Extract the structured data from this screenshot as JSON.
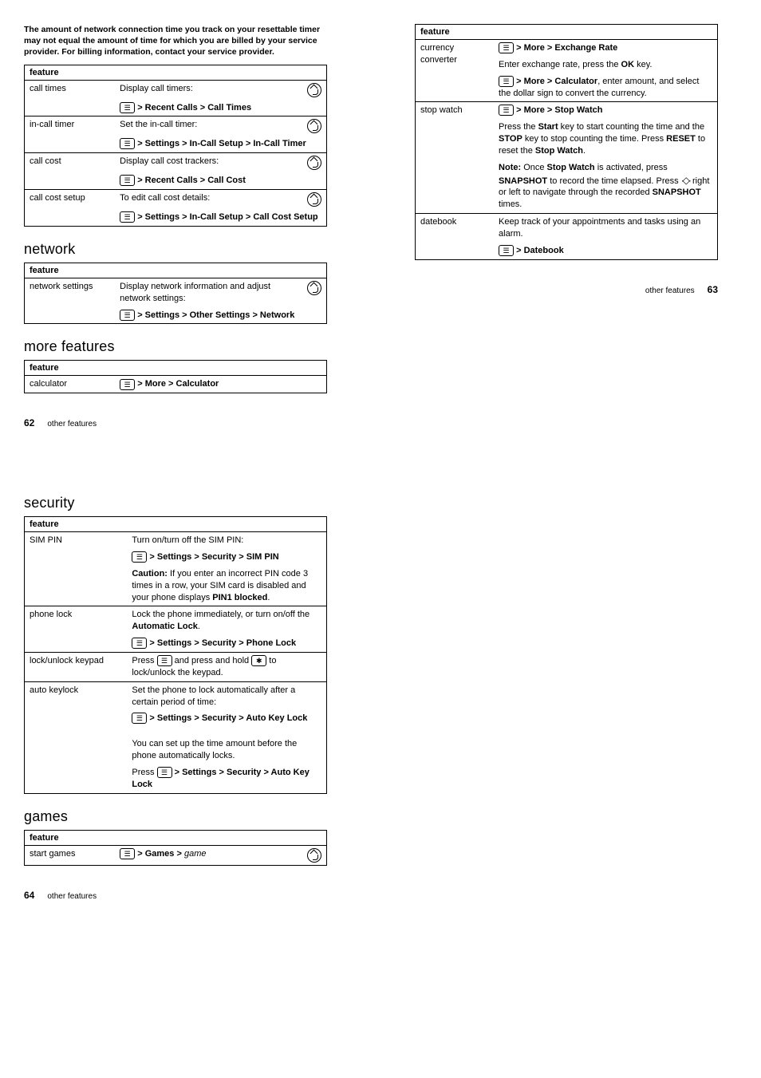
{
  "intro": "The amount of network connection time you track on your resettable timer may not equal the amount of time for which you are billed by your service provider. For billing information, contact your service provider.",
  "header_feature": "feature",
  "sections": {
    "network": "network",
    "more_features": "more features",
    "security": "security",
    "games": "games"
  },
  "t1": {
    "r1l": "call times",
    "r1d": "Display call timers:",
    "r1p": " > Recent Calls > Call Times",
    "r2l": "in-call timer",
    "r2d": "Set the in-call timer:",
    "r2p": " > Settings > In-Call Setup > In-Call Timer",
    "r3l": "call cost",
    "r3d": "Display call cost trackers:",
    "r3p": " > Recent Calls > Call Cost",
    "r4l": "call cost setup",
    "r4d": "To edit call cost details:",
    "r4p": " > Settings > In-Call Setup > Call Cost Setup"
  },
  "t2": {
    "r1l": "network settings",
    "r1d": "Display network information and adjust network settings:",
    "r1p": " > Settings > Other Settings > Network"
  },
  "t3": {
    "r1l": "calculator",
    "r1p": " > More > Calculator"
  },
  "t4": {
    "r1l": "currency converter",
    "r1p1": " > More > Exchange Rate",
    "r1d2a": "Enter exchange rate, press the ",
    "r1d2b": "OK",
    "r1d2c": " key.",
    "r1p3": " > More > Calculator",
    "r1d3b": ", enter amount, and select the dollar sign to convert the currency.",
    "r2l": "stop watch",
    "r2p1": " > More > Stop Watch",
    "r2d2a": "Press the ",
    "r2d2b": "Start",
    "r2d2c": " key to start counting the time and the ",
    "r2d2d": "STOP",
    "r2d2e": " key to stop counting the time. Press ",
    "r2d2f": "RESET",
    "r2d2g": " to reset the ",
    "r2d2h": "Stop Watch",
    "r2d2i": ".",
    "r2n1": "Note:",
    "r2n2": " Once ",
    "r2n3": "Stop Watch",
    "r2n4": " is activated, press ",
    "r2n5": "SNAPSHOT",
    "r2n6": " to record the time elapsed. Press ",
    "r2n7": " right or left to navigate through the recorded ",
    "r2n8": "SNAPSHOT",
    "r2n9": " times.",
    "r3l": "datebook",
    "r3d": "Keep track of your appointments and tasks using an alarm.",
    "r3p": " > Datebook"
  },
  "t5": {
    "r1l": "SIM PIN",
    "r1d": "Turn on/turn off the SIM PIN:",
    "r1p": " > Settings > Security > SIM PIN",
    "r1c1": "Caution:",
    "r1c2": " If you enter an incorrect PIN code 3 times in a row, your SIM card is disabled and your phone displays ",
    "r1c3": "PIN1 blocked",
    "r1c4": ".",
    "r2l": "phone lock",
    "r2d1": "Lock the phone immediately, or turn on/off the ",
    "r2d2": "Automatic Lock",
    "r2d3": ".",
    "r2p": " > Settings > Security > Phone Lock",
    "r3l": "lock/unlock keypad",
    "r3d1": "Press ",
    "r3d2": " and press and hold ",
    "r3d3": " to lock/unlock the keypad.",
    "r4l": "auto keylock",
    "r4d": "Set the phone to lock automatically after a certain period of time:",
    "r4p": " > Settings > Security > Auto Key Lock",
    "r4d2": "You can set up the time amount before the phone automatically locks.",
    "r4d3a": "Press ",
    "r4p2": " > Settings > Security > Auto Key Lock"
  },
  "t6": {
    "r1l": "start games",
    "r1p": " > Games > ",
    "r1g": "game"
  },
  "footer": {
    "label": "other features",
    "p62": "62",
    "p63": "63",
    "p64": "64"
  }
}
